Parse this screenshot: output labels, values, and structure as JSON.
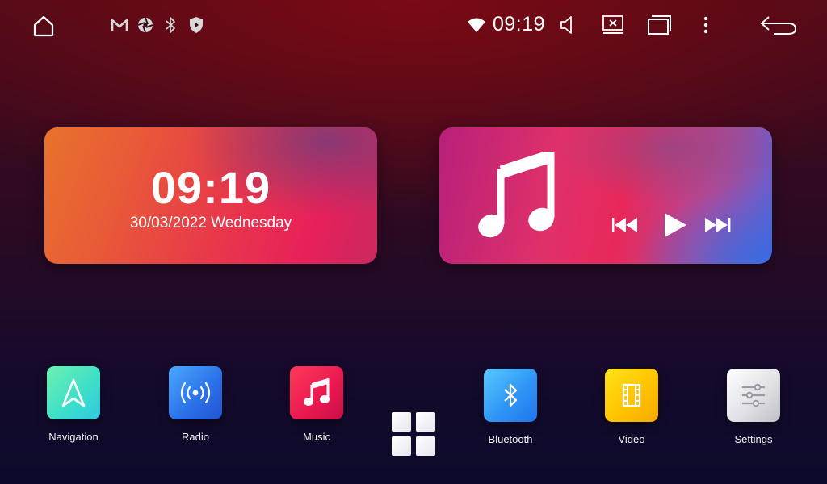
{
  "status_bar": {
    "time": "09:19",
    "icons": [
      "home-icon",
      "gmail-icon",
      "aperture-icon",
      "bluetooth-icon",
      "shield-icon",
      "wifi-icon",
      "volume-icon",
      "screen-off-icon",
      "recent-apps-icon",
      "more-icon",
      "back-icon"
    ]
  },
  "clock_widget": {
    "time": "09:19",
    "date": "30/03/2022 Wednesday"
  },
  "music_widget": {
    "icons": [
      "music-note-icon",
      "previous-icon",
      "play-icon",
      "next-icon"
    ]
  },
  "dock": {
    "apps": [
      {
        "label": "Navigation",
        "icon": "navigation-arrow-icon"
      },
      {
        "label": "Radio",
        "icon": "radio-waves-icon"
      },
      {
        "label": "Music",
        "icon": "music-note-icon"
      },
      {
        "label": "Bluetooth",
        "icon": "bluetooth-icon"
      },
      {
        "label": "Video",
        "icon": "film-icon"
      },
      {
        "label": "Settings",
        "icon": "sliders-icon"
      }
    ],
    "all_apps_icon": "app-grid-icon"
  },
  "colors": {
    "navigation": "#3ee0c8",
    "radio": "#2a6fe8",
    "music": "#e81850",
    "bluetooth": "#2f96f6",
    "video": "#ffc400",
    "settings": "#e2e2e6"
  }
}
